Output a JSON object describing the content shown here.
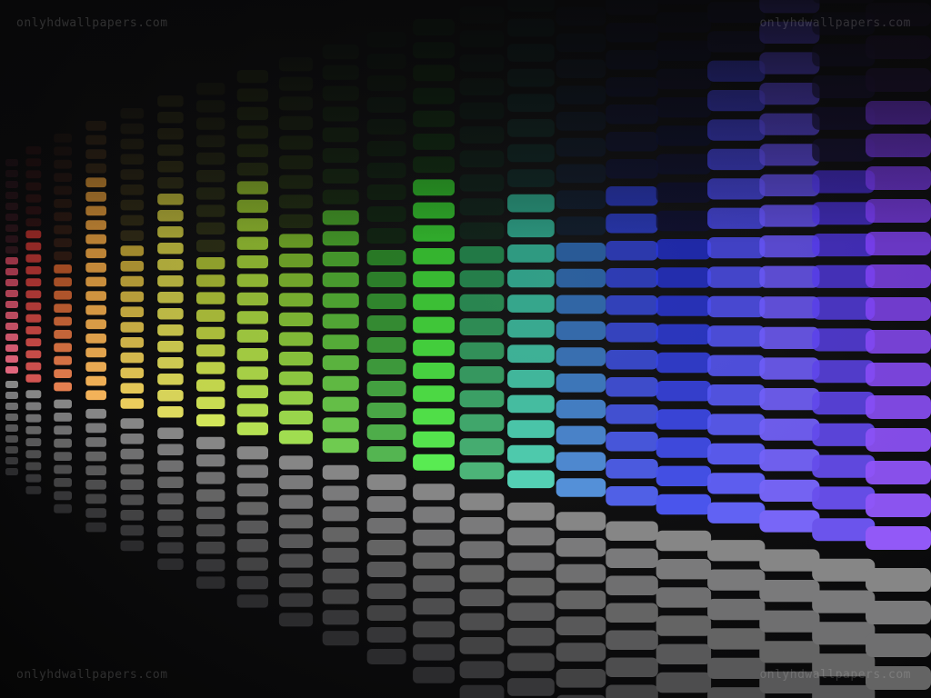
{
  "image": {
    "background_color": "#0b0b0c",
    "watermarks": {
      "top_left": "onlyhdwallpapers.com",
      "top_right": "onlyhdwallpapers.com",
      "bottom_left": "onlyhdwallpapers.com",
      "bottom_right": "onlyhdwallpapers.com"
    },
    "equalizer": {
      "reflection_color": "#9a9a9a",
      "columns": [
        {
          "color": "#d9455f",
          "level": 0.55
        },
        {
          "color": "#c9302c",
          "level": 0.63
        },
        {
          "color": "#e0642a",
          "level": 0.5
        },
        {
          "color": "#f0a135",
          "level": 0.78
        },
        {
          "color": "#e6c23a",
          "level": 0.55
        },
        {
          "color": "#d7d23b",
          "level": 0.7
        },
        {
          "color": "#c8e034",
          "level": 0.52
        },
        {
          "color": "#a5d92c",
          "level": 0.72
        },
        {
          "color": "#8bd52a",
          "level": 0.55
        },
        {
          "color": "#4fc02a",
          "level": 0.62
        },
        {
          "color": "#2fa52b",
          "level": 0.5
        },
        {
          "color": "#35e62c",
          "level": 0.66
        },
        {
          "color": "#25a45a",
          "level": 0.5
        },
        {
          "color": "#2fc6a3",
          "level": 0.6
        },
        {
          "color": "#2f78cf",
          "level": 0.48
        },
        {
          "color": "#2a3de0",
          "level": 0.58
        },
        {
          "color": "#2230e8",
          "level": 0.5
        },
        {
          "color": "#3e3ff0",
          "level": 0.78
        },
        {
          "color": "#5a45f5",
          "level": 0.92
        },
        {
          "color": "#4a2ee8",
          "level": 0.6
        },
        {
          "color": "#7a35f5",
          "level": 0.72
        }
      ]
    }
  }
}
